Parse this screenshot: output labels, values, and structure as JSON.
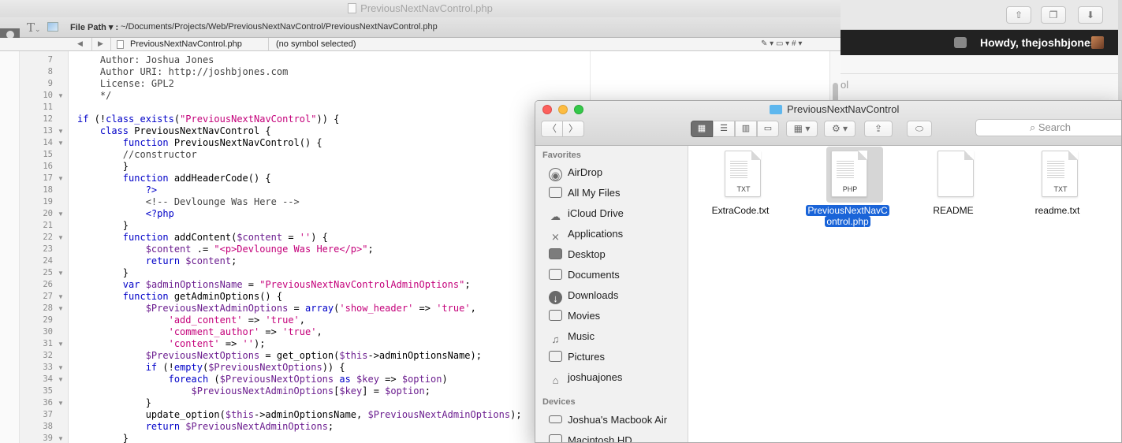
{
  "browser": {
    "wp_greeting": "Howdy, thejoshbjones",
    "snippet": "ol",
    "buttons": [
      "share-icon",
      "tabs-icon",
      "download-icon"
    ]
  },
  "editor": {
    "window_title": "PreviousNextNavControl.php",
    "filepath_label": "File Path ▾ :",
    "filepath_value": "~/Documents/Projects/Web/PreviousNextNavControl/PreviousNextNavControl.php",
    "nav_file": "PreviousNextNavControl.php",
    "nav_symbol": "(no symbol selected)",
    "nav_tools": "✎ ▾  ▭ ▾  #  ▾",
    "line_numbers": [
      "7",
      "8",
      "9",
      "10",
      "11",
      "12",
      "13",
      "14",
      "15",
      "16",
      "17",
      "18",
      "19",
      "20",
      "21",
      "22",
      "23",
      "24",
      "25",
      "26",
      "27",
      "28",
      "29",
      "30",
      "31",
      "32",
      "33",
      "34",
      "35",
      "36",
      "37",
      "38",
      "39"
    ],
    "fold_lines": [
      "10",
      "13",
      "14",
      "17",
      "20",
      "22",
      "25",
      "27",
      "28",
      "31",
      "33",
      "34",
      "36",
      "39"
    ]
  },
  "finder": {
    "title": "PreviousNextNavControl",
    "search_placeholder": "Search",
    "sidebar": {
      "favorites_header": "Favorites",
      "favorites": [
        {
          "label": "AirDrop",
          "icon": "airdrop-icon"
        },
        {
          "label": "All My Files",
          "icon": "all-my-files-icon"
        },
        {
          "label": "iCloud Drive",
          "icon": "cloud-icon"
        },
        {
          "label": "Applications",
          "icon": "applications-icon"
        },
        {
          "label": "Desktop",
          "icon": "desktop-icon"
        },
        {
          "label": "Documents",
          "icon": "documents-icon"
        },
        {
          "label": "Downloads",
          "icon": "downloads-icon"
        },
        {
          "label": "Movies",
          "icon": "movies-icon"
        },
        {
          "label": "Music",
          "icon": "music-icon"
        },
        {
          "label": "Pictures",
          "icon": "pictures-icon"
        },
        {
          "label": "joshuajones",
          "icon": "home-icon"
        }
      ],
      "devices_header": "Devices",
      "devices": [
        {
          "label": "Joshua's Macbook Air",
          "icon": "laptop-icon"
        },
        {
          "label": "Macintosh HD",
          "icon": "disk-icon"
        }
      ]
    },
    "files": [
      {
        "name": "ExtraCode.txt",
        "ext": "TXT",
        "selected": false
      },
      {
        "name": "PreviousNextNavControl.php",
        "ext": "PHP",
        "selected": true
      },
      {
        "name": "README",
        "ext": "",
        "selected": false
      },
      {
        "name": "readme.txt",
        "ext": "TXT",
        "selected": false
      }
    ],
    "file_php_name_line1": "PreviousNextNavC",
    "file_php_name_line2": "ontrol.php"
  },
  "colors": {
    "keyword": "#0000c8",
    "string": "#c4007a",
    "variable": "#6b1d8f",
    "selection": "#1a64d8"
  }
}
